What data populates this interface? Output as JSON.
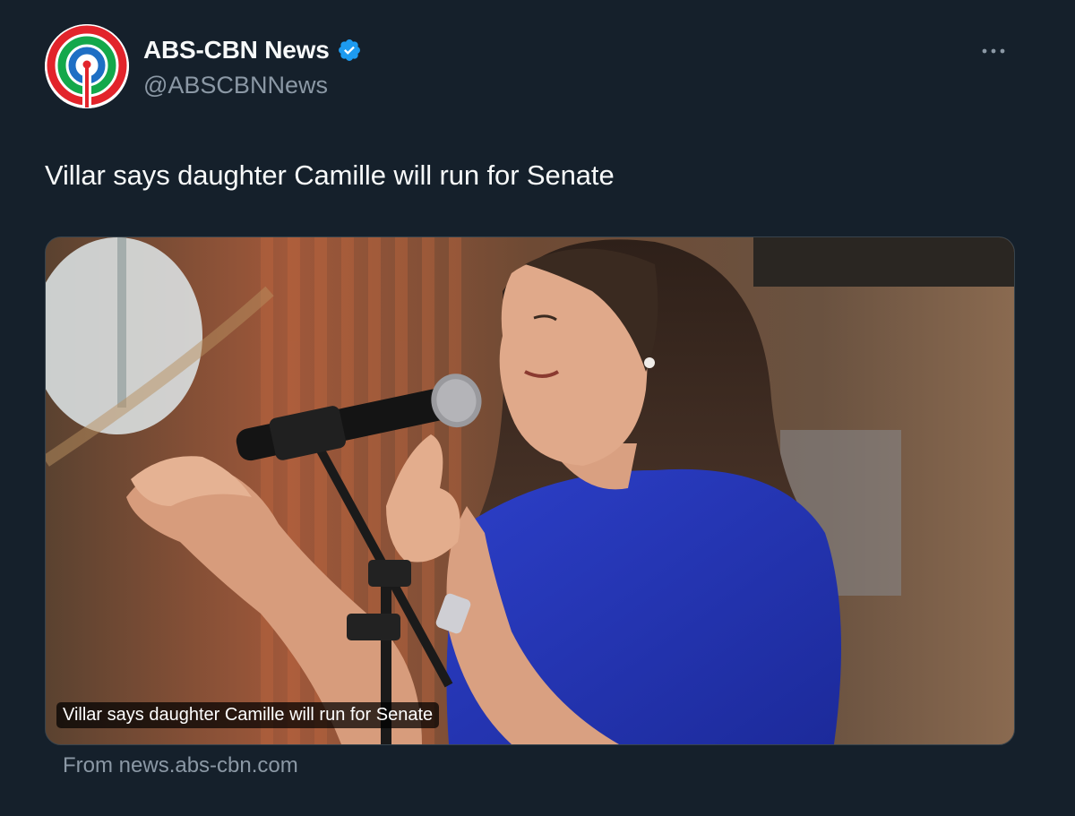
{
  "author": {
    "display_name": "ABS-CBN News",
    "handle": "@ABSCBNNews",
    "verified_icon": "verified-badge-icon",
    "avatar_icon": "abs-cbn-logo-icon"
  },
  "tweet": {
    "text": "Villar says daughter Camille will run for Senate"
  },
  "card": {
    "image_caption": "Villar says daughter Camille will run for Senate",
    "source": "From news.abs-cbn.com"
  },
  "colors": {
    "background": "#15202b",
    "text_primary": "#f7f9f9",
    "text_secondary": "#8b98a5",
    "verified_blue": "#1d9bf0"
  }
}
